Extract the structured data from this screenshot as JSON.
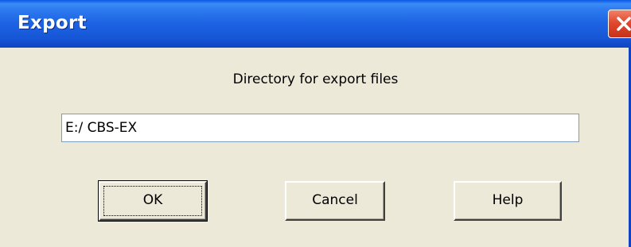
{
  "window": {
    "title": "Export",
    "close_icon": "close-icon",
    "titlebar_color": "#1C62E2",
    "close_color": "#E2492E",
    "body_color": "#ECE9D8"
  },
  "form": {
    "prompt": "Directory for export files",
    "directory_value": "E:/ CBS-EX"
  },
  "buttons": {
    "ok": "OK",
    "cancel": "Cancel",
    "help": "Help"
  }
}
